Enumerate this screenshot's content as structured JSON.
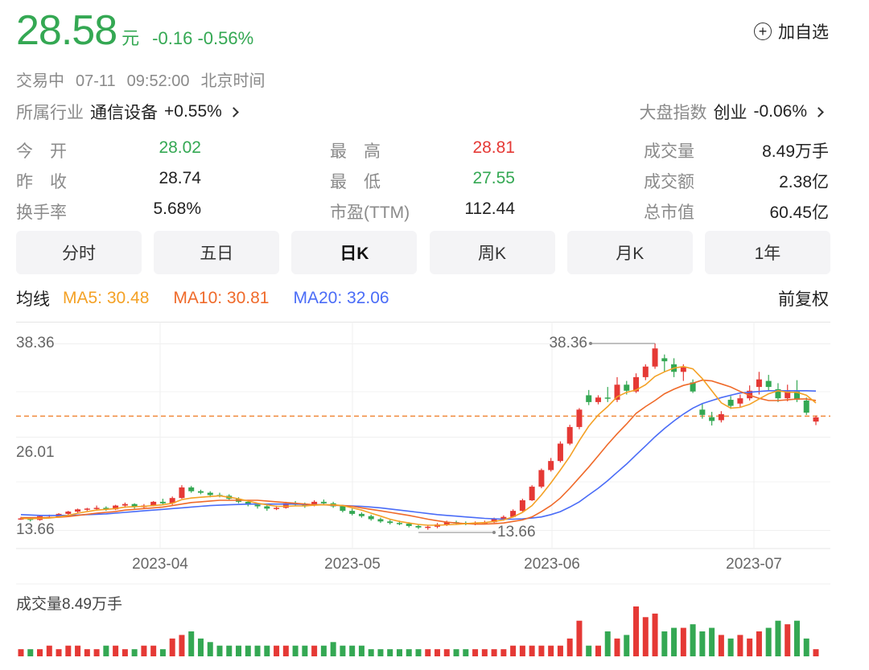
{
  "quote": {
    "price": "28.58",
    "unit": "元",
    "change": "-0.16",
    "change_pct": "-0.56%",
    "watch_label": "加自选",
    "status": "交易中",
    "date": "07-11",
    "time": "09:52:00",
    "timezone": "北京时间"
  },
  "industry": {
    "label": "所属行业",
    "name": "通信设备",
    "pct": "+0.55%"
  },
  "index": {
    "label": "大盘指数",
    "name": "创业",
    "pct": "-0.06%"
  },
  "stats": {
    "open": {
      "label": "今　开",
      "value": "28.02"
    },
    "high": {
      "label": "最　高",
      "value": "28.81"
    },
    "volume": {
      "label": "成交量",
      "value": "8.49万手"
    },
    "prev_close": {
      "label": "昨　收",
      "value": "28.74"
    },
    "low": {
      "label": "最　低",
      "value": "27.55"
    },
    "amount": {
      "label": "成交额",
      "value": "2.38亿"
    },
    "turnover": {
      "label": "换手率",
      "value": "5.68%"
    },
    "pe": {
      "label": "市盈(TTM)",
      "value": "112.44"
    },
    "mktcap": {
      "label": "总市值",
      "value": "60.45亿"
    }
  },
  "tabs": [
    "分时",
    "五日",
    "日K",
    "周K",
    "月K",
    "1年"
  ],
  "active_tab": "日K",
  "ma": {
    "label": "均线",
    "ma5": "MA5: 30.48",
    "ma10": "MA10: 30.81",
    "ma20": "MA20: 32.06",
    "adjust": "前复权"
  },
  "volume_label": "成交量8.49万手",
  "colors": {
    "up": "#e53935",
    "down": "#34a853",
    "ma5": "#f4a125",
    "ma10": "#ef6a2a",
    "ma20": "#4a6cf7"
  },
  "chart_data": {
    "type": "candlestick",
    "y_ticks": [
      "38.36",
      "26.01",
      "13.66"
    ],
    "x_ticks": [
      "2023-04",
      "2023-05",
      "2023-06",
      "2023-07"
    ],
    "ylim": [
      13.66,
      38.36
    ],
    "reference_price": 28.74,
    "max_annotation": "38.36",
    "min_annotation": "13.66",
    "candles": [
      [
        15.1,
        15.4,
        15.0,
        15.2
      ],
      [
        15.2,
        15.3,
        14.8,
        15.0
      ],
      [
        15.0,
        15.6,
        14.9,
        15.5
      ],
      [
        15.4,
        15.7,
        15.2,
        15.4
      ],
      [
        15.4,
        15.9,
        15.3,
        15.8
      ],
      [
        15.8,
        16.2,
        15.6,
        16.1
      ],
      [
        16.1,
        16.5,
        15.9,
        16.4
      ],
      [
        16.4,
        16.6,
        16.2,
        16.5
      ],
      [
        16.5,
        16.9,
        16.3,
        16.6
      ],
      [
        16.6,
        16.8,
        16.2,
        16.4
      ],
      [
        16.4,
        17.0,
        16.3,
        16.9
      ],
      [
        16.9,
        17.3,
        16.6,
        17.1
      ],
      [
        17.1,
        17.2,
        16.5,
        16.7
      ],
      [
        16.7,
        17.1,
        16.5,
        16.9
      ],
      [
        16.9,
        17.5,
        16.8,
        17.4
      ],
      [
        17.4,
        17.8,
        17.0,
        17.2
      ],
      [
        17.2,
        18.1,
        17.0,
        17.9
      ],
      [
        17.9,
        19.6,
        17.8,
        19.3
      ],
      [
        19.3,
        19.5,
        18.6,
        18.8
      ],
      [
        18.8,
        19.0,
        18.4,
        18.6
      ],
      [
        18.6,
        18.8,
        18.0,
        18.3
      ],
      [
        18.3,
        18.6,
        18.0,
        18.2
      ],
      [
        18.2,
        18.4,
        17.6,
        17.8
      ],
      [
        17.8,
        18.0,
        17.2,
        17.4
      ],
      [
        17.4,
        17.6,
        16.8,
        17.0
      ],
      [
        17.0,
        17.2,
        16.5,
        16.8
      ],
      [
        16.8,
        17.0,
        16.2,
        16.5
      ],
      [
        16.5,
        16.9,
        16.3,
        16.6
      ],
      [
        16.6,
        17.4,
        16.5,
        17.2
      ],
      [
        17.2,
        17.5,
        16.9,
        17.0
      ],
      [
        17.0,
        17.3,
        16.6,
        16.9
      ],
      [
        16.9,
        17.6,
        16.8,
        17.4
      ],
      [
        17.4,
        17.7,
        17.0,
        17.2
      ],
      [
        17.2,
        17.4,
        16.6,
        16.8
      ],
      [
        16.8,
        17.0,
        16.0,
        16.2
      ],
      [
        16.2,
        16.5,
        15.6,
        15.8
      ],
      [
        15.8,
        16.0,
        15.3,
        15.5
      ],
      [
        15.5,
        15.7,
        14.9,
        15.1
      ],
      [
        15.1,
        15.3,
        14.6,
        14.8
      ],
      [
        14.8,
        15.0,
        14.4,
        14.6
      ],
      [
        14.6,
        14.9,
        14.3,
        14.5
      ],
      [
        14.5,
        14.7,
        14.0,
        14.2
      ],
      [
        14.2,
        14.4,
        13.8,
        14.0
      ],
      [
        14.0,
        14.3,
        13.7,
        14.1
      ],
      [
        14.1,
        14.6,
        13.9,
        14.4
      ],
      [
        14.4,
        14.9,
        14.2,
        14.7
      ],
      [
        14.7,
        14.9,
        14.4,
        14.6
      ],
      [
        14.6,
        14.8,
        14.3,
        14.5
      ],
      [
        14.5,
        14.8,
        14.3,
        14.6
      ],
      [
        14.6,
        14.9,
        14.4,
        14.7
      ],
      [
        14.7,
        15.3,
        14.6,
        15.1
      ],
      [
        15.1,
        15.6,
        14.9,
        15.4
      ],
      [
        15.4,
        16.4,
        15.3,
        16.2
      ],
      [
        16.2,
        17.8,
        16.1,
        17.6
      ],
      [
        17.6,
        19.6,
        17.5,
        19.4
      ],
      [
        19.4,
        21.8,
        19.2,
        21.6
      ],
      [
        21.6,
        23.2,
        21.4,
        22.8
      ],
      [
        22.8,
        25.4,
        22.6,
        25.1
      ],
      [
        25.1,
        27.6,
        24.9,
        27.3
      ],
      [
        27.3,
        29.8,
        27.0,
        29.6
      ],
      [
        31.5,
        32.2,
        30.2,
        30.6
      ],
      [
        30.6,
        31.5,
        30.3,
        31.2
      ],
      [
        31.2,
        32.6,
        30.6,
        31.1
      ],
      [
        30.9,
        33.9,
        30.6,
        32.9
      ],
      [
        32.9,
        33.4,
        31.6,
        32.1
      ],
      [
        32.0,
        34.4,
        31.8,
        33.9
      ],
      [
        33.9,
        35.6,
        33.5,
        35.3
      ],
      [
        35.3,
        38.36,
        35.0,
        37.7
      ],
      [
        36.4,
        36.9,
        34.6,
        36.0
      ],
      [
        35.6,
        36.4,
        33.9,
        34.6
      ],
      [
        34.6,
        35.6,
        33.4,
        35.2
      ],
      [
        33.2,
        33.6,
        31.8,
        32.0
      ],
      [
        29.6,
        30.4,
        28.4,
        28.9
      ],
      [
        28.6,
        29.3,
        27.5,
        28.1
      ],
      [
        28.2,
        29.4,
        27.9,
        29.0
      ],
      [
        30.9,
        31.4,
        29.7,
        30.1
      ],
      [
        30.4,
        31.6,
        29.9,
        31.1
      ],
      [
        31.1,
        32.8,
        30.8,
        32.1
      ],
      [
        32.6,
        34.6,
        31.6,
        33.6
      ],
      [
        33.4,
        34.2,
        32.1,
        32.6
      ],
      [
        32.3,
        33.1,
        30.6,
        31.1
      ],
      [
        31.1,
        32.9,
        30.7,
        32.0
      ],
      [
        32.0,
        33.5,
        30.6,
        30.9
      ],
      [
        30.8,
        31.2,
        28.9,
        29.2
      ],
      [
        28.02,
        28.81,
        27.55,
        28.58
      ]
    ],
    "ma5": [
      15.2,
      15.15,
      15.2,
      15.25,
      15.4,
      15.6,
      15.9,
      16.1,
      16.3,
      16.4,
      16.5,
      16.7,
      16.75,
      16.8,
      16.9,
      17.0,
      17.2,
      17.7,
      17.9,
      18.0,
      18.1,
      18.2,
      18.0,
      17.8,
      17.5,
      17.2,
      17.0,
      16.8,
      16.8,
      16.85,
      16.85,
      16.95,
      17.0,
      17.0,
      16.9,
      16.6,
      16.3,
      15.9,
      15.5,
      15.1,
      14.8,
      14.6,
      14.4,
      14.3,
      14.3,
      14.35,
      14.4,
      14.5,
      14.6,
      14.65,
      14.8,
      15.0,
      15.4,
      16.0,
      16.9,
      18.3,
      19.9,
      21.6,
      23.4,
      25.5,
      27.4,
      28.9,
      30.0,
      31.3,
      31.9,
      32.2,
      32.9,
      34.0,
      34.6,
      35.1,
      35.3,
      35.0,
      33.7,
      32.1,
      30.5,
      29.8,
      29.9,
      30.3,
      31.0,
      31.7,
      32.1,
      31.9,
      31.9,
      31.5,
      30.48
    ],
    "ma10": [
      15.3,
      15.3,
      15.3,
      15.3,
      15.35,
      15.45,
      15.6,
      15.75,
      15.9,
      16.0,
      16.1,
      16.3,
      16.4,
      16.5,
      16.6,
      16.7,
      16.9,
      17.1,
      17.3,
      17.4,
      17.5,
      17.6,
      17.6,
      17.6,
      17.6,
      17.6,
      17.5,
      17.4,
      17.3,
      17.2,
      17.1,
      17.0,
      17.0,
      16.95,
      16.9,
      16.8,
      16.6,
      16.4,
      16.2,
      16.0,
      15.8,
      15.6,
      15.35,
      15.1,
      14.9,
      14.7,
      14.6,
      14.5,
      14.45,
      14.45,
      14.5,
      14.6,
      14.8,
      15.0,
      15.4,
      16.1,
      16.9,
      17.9,
      19.2,
      20.6,
      22.0,
      23.5,
      25.0,
      26.4,
      27.7,
      29.1,
      30.0,
      30.8,
      31.7,
      32.3,
      32.8,
      33.1,
      33.5,
      33.4,
      33.0,
      32.6,
      32.0,
      31.5,
      31.1,
      30.8,
      30.8,
      30.9,
      31.0,
      31.0,
      30.81
    ],
    "ma20": [
      15.7,
      15.65,
      15.6,
      15.6,
      15.6,
      15.6,
      15.65,
      15.7,
      15.75,
      15.8,
      15.9,
      16.0,
      16.1,
      16.2,
      16.3,
      16.4,
      16.5,
      16.6,
      16.7,
      16.8,
      16.9,
      16.95,
      17.0,
      17.05,
      17.1,
      17.1,
      17.1,
      17.1,
      17.1,
      17.1,
      17.05,
      17.0,
      17.0,
      16.95,
      16.9,
      16.85,
      16.8,
      16.7,
      16.6,
      16.45,
      16.3,
      16.15,
      16.0,
      15.85,
      15.7,
      15.6,
      15.5,
      15.4,
      15.3,
      15.2,
      15.15,
      15.1,
      15.1,
      15.15,
      15.25,
      15.4,
      15.7,
      16.1,
      16.7,
      17.4,
      18.3,
      19.2,
      20.2,
      21.3,
      22.4,
      23.6,
      24.8,
      26.0,
      27.1,
      28.1,
      29.0,
      29.8,
      30.4,
      30.8,
      31.2,
      31.5,
      31.8,
      31.9,
      32.0,
      32.1,
      32.1,
      32.1,
      32.1,
      32.1,
      32.06
    ],
    "volume": [
      2,
      2,
      2,
      3,
      2,
      3,
      3,
      2,
      2,
      3,
      3,
      2,
      2,
      3,
      3,
      2,
      5,
      6,
      7,
      5,
      4,
      3,
      3,
      3,
      3,
      3,
      3,
      3,
      3,
      3,
      3,
      3,
      3,
      4,
      3,
      3,
      3,
      2,
      2,
      2,
      2,
      2,
      2,
      2,
      2,
      2,
      2,
      2,
      2,
      2,
      2,
      2,
      3,
      3,
      3,
      3,
      3,
      3,
      5,
      10,
      3,
      3,
      7,
      5,
      6,
      14,
      11,
      12,
      7,
      8,
      8,
      9,
      7,
      8,
      6,
      5,
      6,
      5,
      7,
      8,
      10,
      9,
      10,
      5,
      2
    ]
  }
}
